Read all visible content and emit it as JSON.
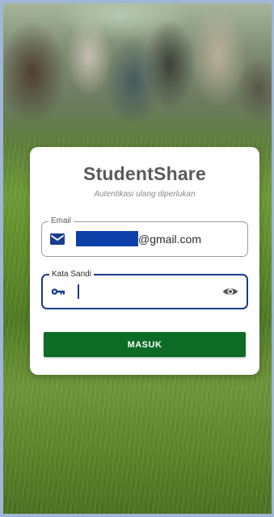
{
  "app": {
    "title": "StudentShare",
    "subtitle": "Autentikasi ulang diperlukan"
  },
  "form": {
    "email": {
      "label": "Email",
      "value_visible": "@gmail.com",
      "icon": "email-icon"
    },
    "password": {
      "label": "Kata Sandi",
      "value": "",
      "icon": "key-icon",
      "toggle_icon": "eye-icon"
    },
    "submit_label": "MASUK"
  },
  "colors": {
    "primary_button": "#0c6b25",
    "focus_border": "#1a3c8a",
    "icon_color": "#1a3c8a",
    "redaction": "#0d3fa8",
    "title": "#5a5a5a"
  }
}
